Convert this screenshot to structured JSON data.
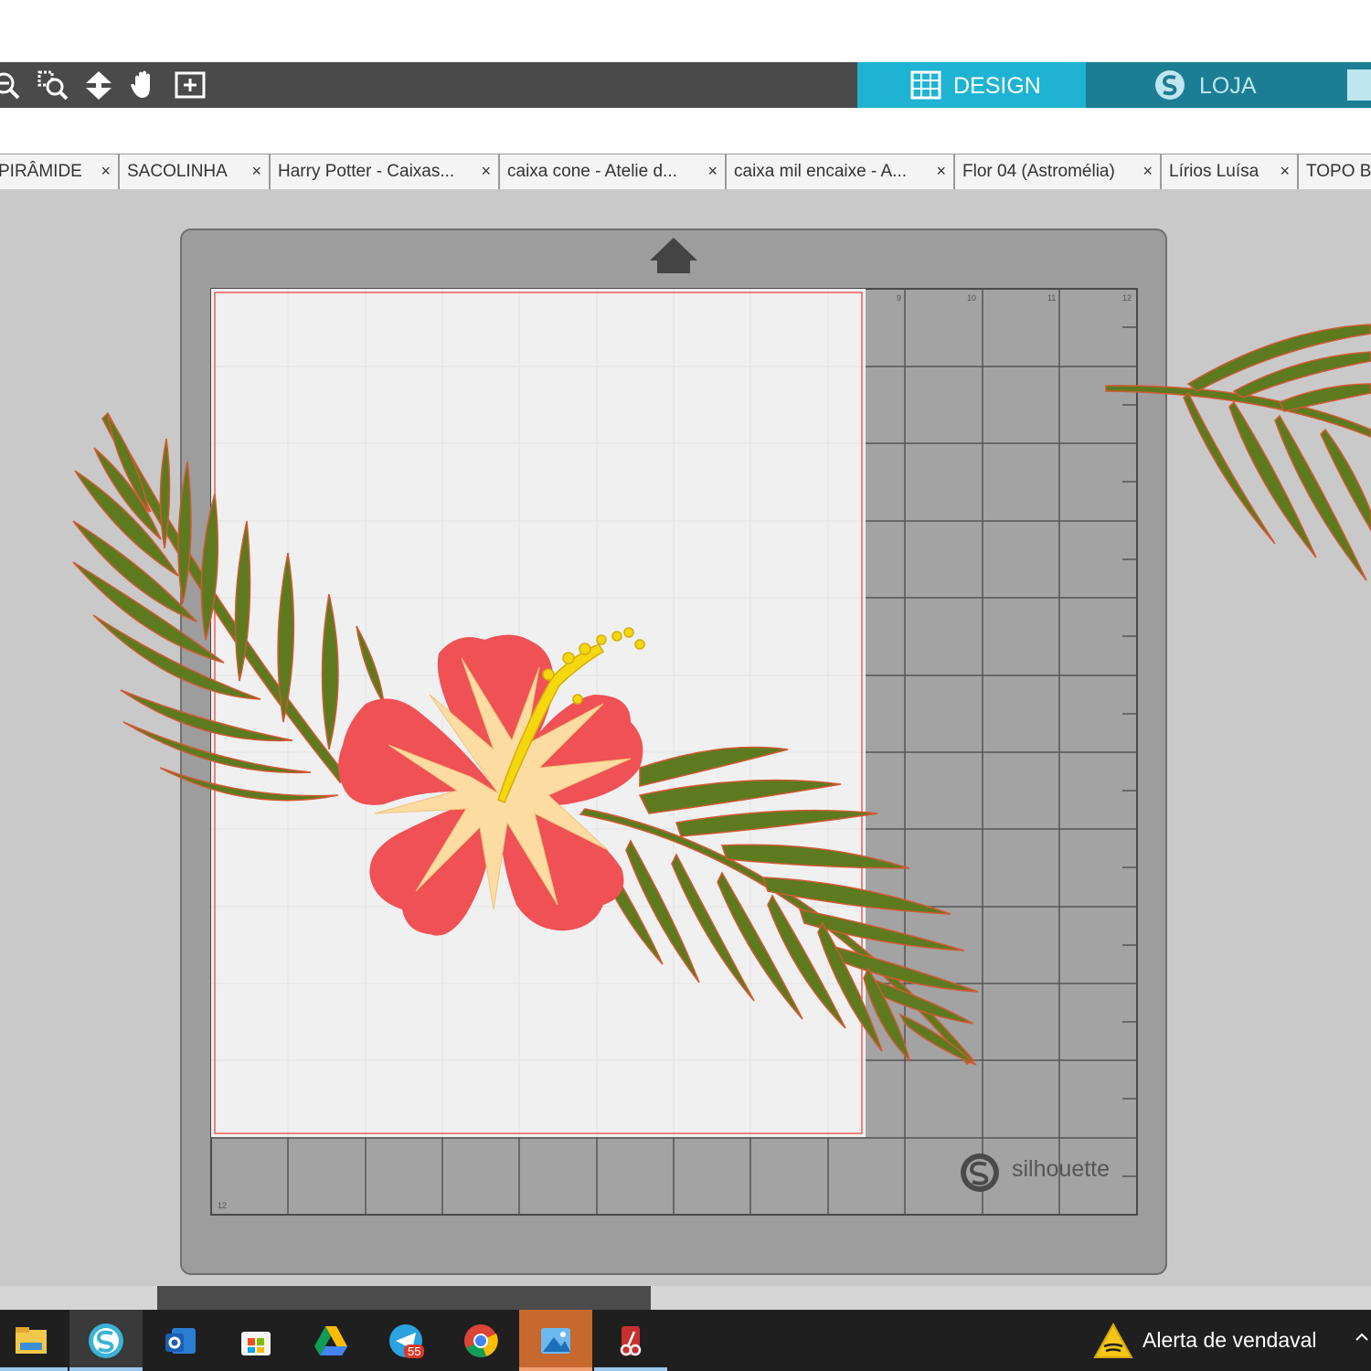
{
  "toolbar": {
    "tools": [
      "zoom-out-icon",
      "zoom-selection-icon",
      "pan-down-icon",
      "hand-icon",
      "fit-page-icon"
    ]
  },
  "modes": {
    "design": {
      "label": "DESIGN",
      "icon": "grid-icon",
      "color": "#1fb3d3"
    },
    "loja": {
      "label": "LOJA",
      "icon": "silhouette-logo-icon",
      "color": "#1b7e94"
    }
  },
  "tabs": [
    {
      "label": "PIRÂMIDE",
      "close": "×"
    },
    {
      "label": "SACOLINHA",
      "close": "×"
    },
    {
      "label": "Harry Potter - Caixas...",
      "close": "×"
    },
    {
      "label": "caixa cone - Atelie d...",
      "close": "×"
    },
    {
      "label": "caixa mil encaixe - A...",
      "close": "×"
    },
    {
      "label": "Flor 04 (Astromélia)",
      "close": "×"
    },
    {
      "label": "Lírios Luísa",
      "close": "×"
    },
    {
      "label": "TOPO B",
      "close": ""
    }
  ],
  "mat": {
    "brand": "silhouette",
    "ruler_top": [
      "9",
      "10",
      "11",
      "12"
    ],
    "ruler_bottom": "12",
    "colors": {
      "paper": "#f0f0f0",
      "mat": "#9d9d9d",
      "cut_line": "#ef5a5a",
      "leaf": "#5d7a1f",
      "petal": "#ef5155",
      "center": "#fcdca3",
      "stamen": "#f5d70d"
    }
  },
  "taskbar": {
    "items": [
      "file-explorer-icon",
      "silhouette-studio-icon",
      "outlook-icon",
      "microsoft-store-icon",
      "google-drive-icon",
      "telegram-icon",
      "chrome-icon",
      "photos-icon",
      "snipping-tool-icon"
    ],
    "telegram_badge": "55",
    "notification": "Alerta de vendaval",
    "notification_icon": "warning-icon"
  }
}
